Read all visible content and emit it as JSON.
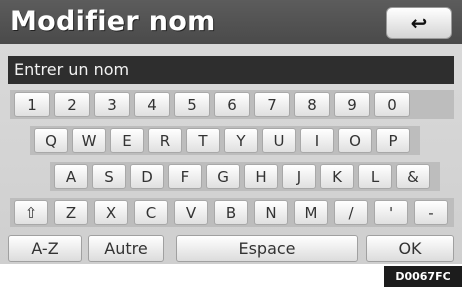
{
  "header": {
    "title": "Modifier nom",
    "back_icon": "↩"
  },
  "input": {
    "value": "Entrer un nom"
  },
  "keyboard": {
    "row1": [
      "1",
      "2",
      "3",
      "4",
      "5",
      "6",
      "7",
      "8",
      "9",
      "0"
    ],
    "row2": [
      "Q",
      "W",
      "E",
      "R",
      "T",
      "Y",
      "U",
      "I",
      "O",
      "P"
    ],
    "row3": [
      "A",
      "S",
      "D",
      "F",
      "G",
      "H",
      "J",
      "K",
      "L",
      "&"
    ],
    "row4": [
      "⇧",
      "Z",
      "X",
      "C",
      "V",
      "B",
      "N",
      "M",
      "/",
      "'",
      "-"
    ]
  },
  "bottom": {
    "az": "A-Z",
    "autre": "Autre",
    "espace": "Espace",
    "ok": "OK"
  },
  "image_code": "D0067FC"
}
